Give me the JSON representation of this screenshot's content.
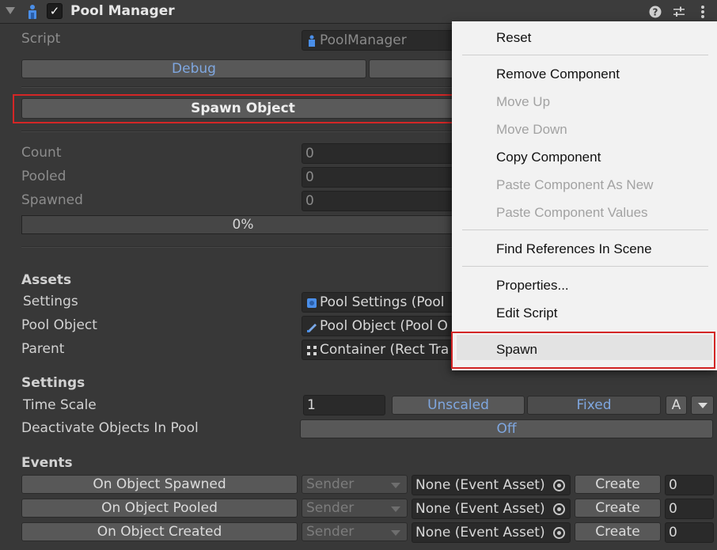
{
  "header": {
    "title": "Pool Manager",
    "enabled": true
  },
  "script_row": {
    "label": "Script",
    "value": "PoolManager"
  },
  "buttons": {
    "debug": "Debug",
    "spawn_object": "Spawn Object"
  },
  "stats": {
    "count_label": "Count",
    "count_value": "0",
    "pooled_label": "Pooled",
    "pooled_value": "0",
    "spawned_label": "Spawned",
    "spawned_value": "0",
    "progress_text": "0%",
    "progress_fraction": 0
  },
  "assets": {
    "heading": "Assets",
    "settings_label": "Settings",
    "settings_value": "Pool Settings (Pool",
    "pool_object_label": "Pool Object",
    "pool_object_value": "Pool Object (Pool O",
    "parent_label": "Parent",
    "parent_value": "Container (Rect Tra"
  },
  "settings": {
    "heading": "Settings",
    "time_scale_label": "Time Scale",
    "time_scale_value": "1",
    "unscaled": "Unscaled",
    "fixed": "Fixed",
    "a_button": "A",
    "deactivate_label": "Deactivate Objects In Pool",
    "deactivate_value": "Off"
  },
  "events": {
    "heading": "Events",
    "rows": [
      {
        "name": "On Object Spawned",
        "sender": "Sender",
        "asset": "None (Event Asset)",
        "create": "Create",
        "count": "0"
      },
      {
        "name": "On Object Pooled",
        "sender": "Sender",
        "asset": "None (Event Asset)",
        "create": "Create",
        "count": "0"
      },
      {
        "name": "On Object Created",
        "sender": "Sender",
        "asset": "None (Event Asset)",
        "create": "Create",
        "count": "0"
      }
    ]
  },
  "context_menu": {
    "reset": "Reset",
    "remove_component": "Remove Component",
    "move_up": "Move Up",
    "move_down": "Move Down",
    "copy_component": "Copy Component",
    "paste_as_new": "Paste Component As New",
    "paste_values": "Paste Component Values",
    "find_references": "Find References In Scene",
    "properties": "Properties...",
    "edit_script": "Edit Script",
    "spawn": "Spawn"
  },
  "colors": {
    "highlight": "#d32626",
    "link_blue": "#7fa7e0",
    "background": "#383838",
    "menu_bg": "#f2f2f2"
  }
}
